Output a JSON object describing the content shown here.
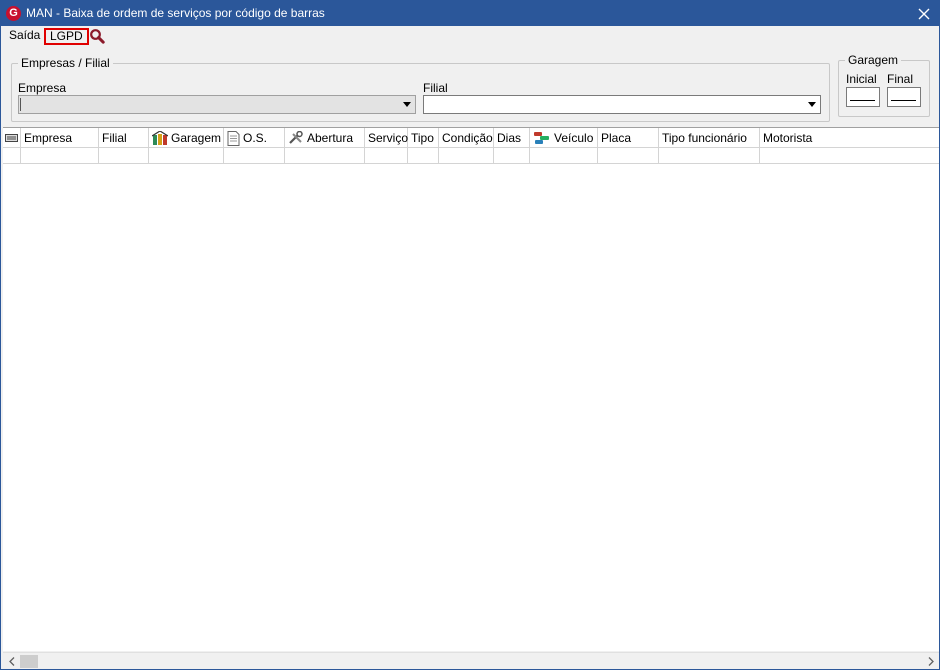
{
  "window": {
    "title": "MAN - Baixa de ordem de serviços por código de barras",
    "app_icon_letter": "G",
    "close_glyph": "✕"
  },
  "menu": {
    "saida": "Saída",
    "lgpd": "LGPD",
    "search_icon": "magnifier-icon"
  },
  "empresas_group": {
    "legend": "Empresas / Filial",
    "empresa_label": "Empresa",
    "filial_label": "Filial",
    "empresa_value": "",
    "filial_value": ""
  },
  "garagem_group": {
    "legend": "Garagem",
    "inicial_label": "Inicial",
    "final_label": "Final",
    "inicial_value": "",
    "final_value": ""
  },
  "grid": {
    "columns": [
      "Empresa",
      "Filial",
      "Garagem",
      "O.S.",
      "Abertura",
      "Serviço",
      "Tipo",
      "Condição",
      "Dias",
      "Veículo",
      "Placa",
      "Tipo funcionário",
      "Motorista"
    ]
  },
  "colors": {
    "titlebar": "#2b579a",
    "highlight": "#e00000"
  }
}
